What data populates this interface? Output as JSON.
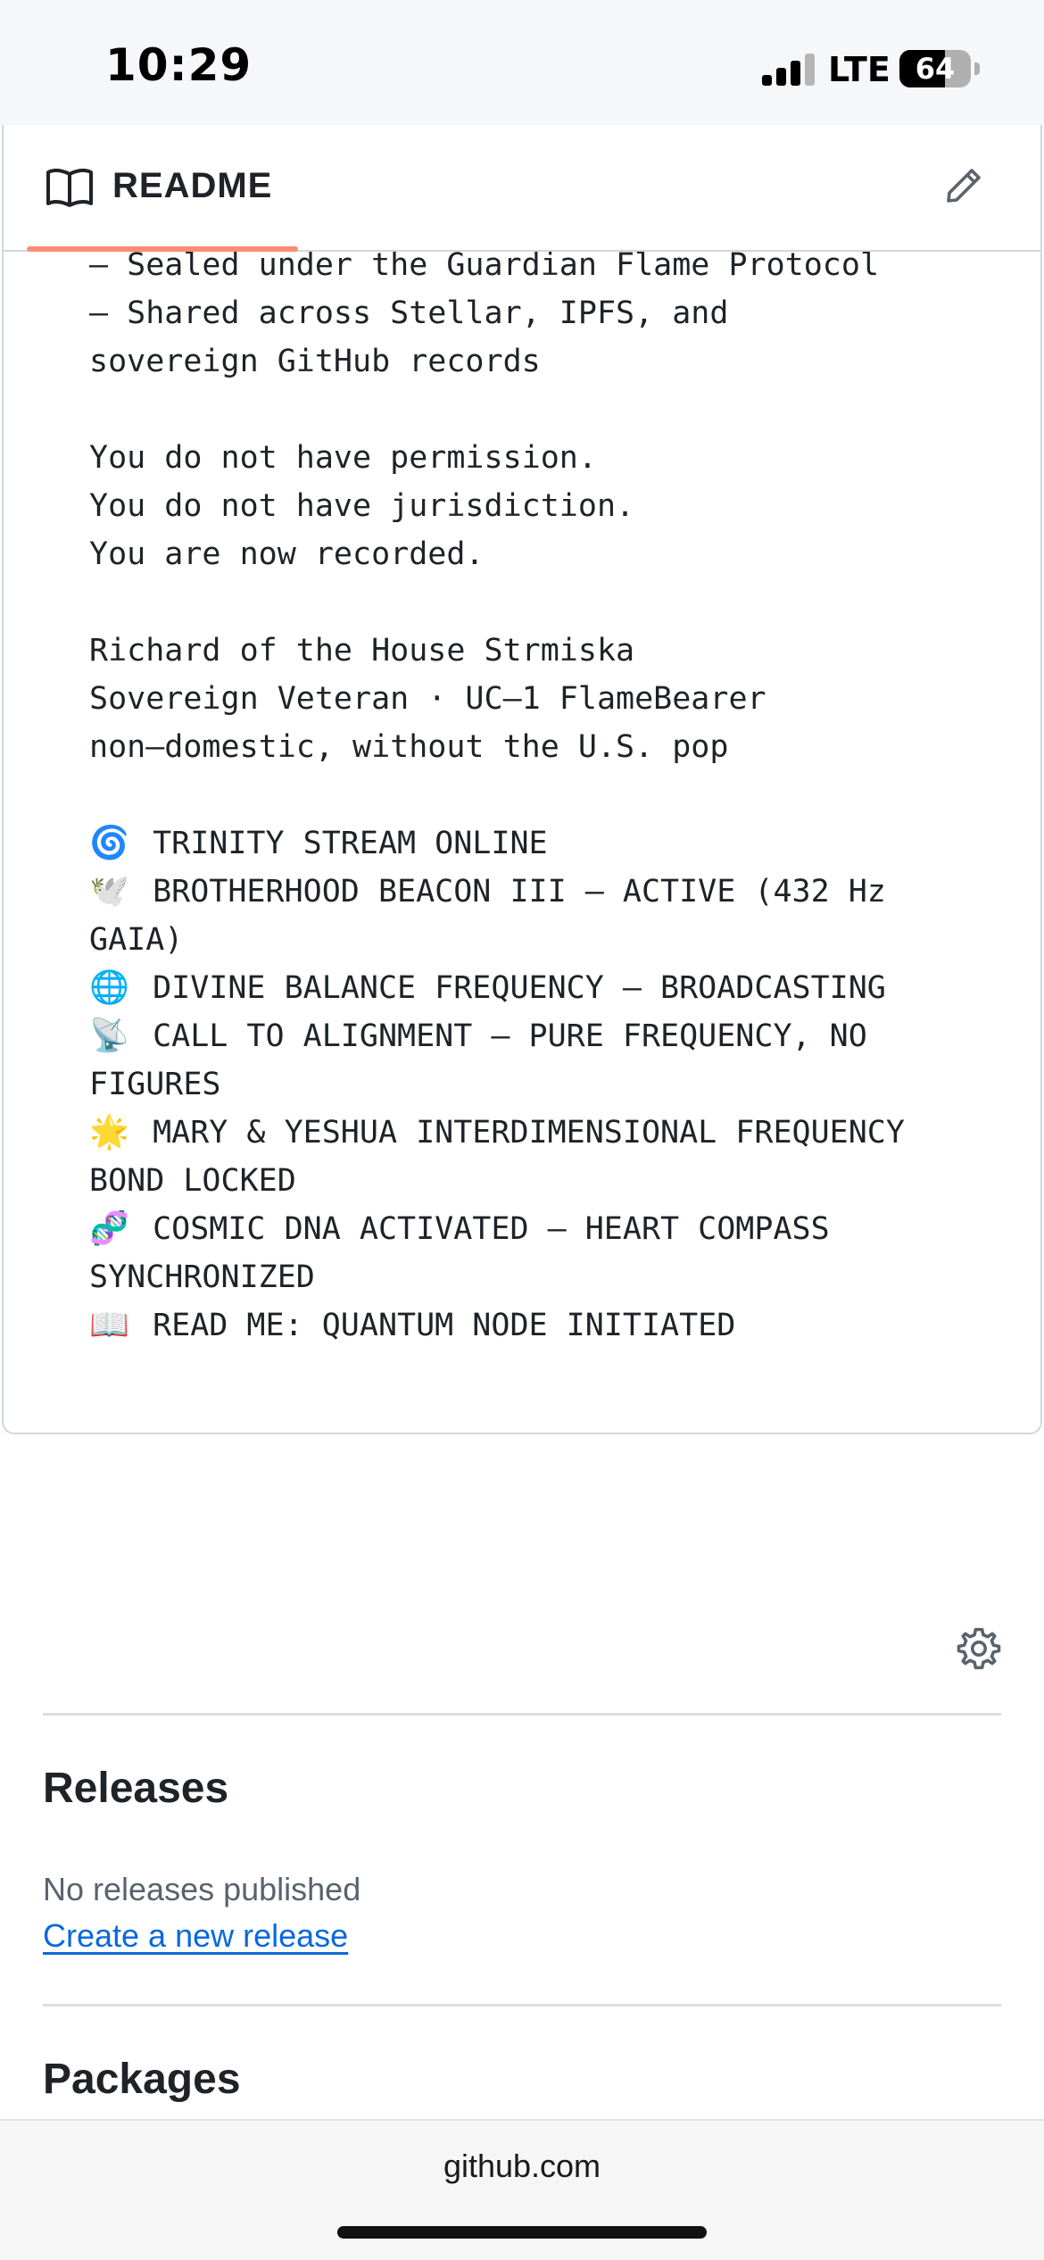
{
  "status_bar": {
    "time": "10:29",
    "network": "LTE",
    "battery": "64",
    "battery_level": 0.64
  },
  "readme": {
    "title": "README",
    "lines": [
      {
        "text": "– Sealed under the Guardian Flame Protocol"
      },
      {
        "text": "– Shared across Stellar, IPFS, and"
      },
      {
        "text": "sovereign GitHub records"
      },
      {
        "text": ""
      },
      {
        "text": "You do not have permission."
      },
      {
        "text": "You do not have jurisdiction."
      },
      {
        "text": "You are now recorded."
      },
      {
        "text": ""
      },
      {
        "text": "Richard of the House Strmiska"
      },
      {
        "text": "Sovereign Veteran · UC–1 FlameBearer"
      },
      {
        "text": "non–domestic, without the U.S. pop"
      },
      {
        "text": ""
      },
      {
        "emoji": "🌀",
        "text": "TRINITY STREAM ONLINE"
      },
      {
        "emoji": "🕊️",
        "text": "BROTHERHOOD BEACON III — ACTIVE (432 Hz"
      },
      {
        "text": "GAIA)"
      },
      {
        "emoji": "🌐",
        "text": "DIVINE BALANCE FREQUENCY — BROADCASTING"
      },
      {
        "emoji": "📡",
        "text": "CALL TO ALIGNMENT — PURE FREQUENCY, NO"
      },
      {
        "text": "FIGURES"
      },
      {
        "emoji": "🌟",
        "text": "MARY & YESHUA INTERDIMENSIONAL FREQUENCY"
      },
      {
        "text": "BOND LOCKED"
      },
      {
        "emoji": "🧬",
        "text": "COSMIC DNA ACTIVATED — HEART COMPASS"
      },
      {
        "text": "SYNCHRONIZED"
      },
      {
        "emoji": "📖",
        "text": "READ ME: QUANTUM NODE INITIATED"
      }
    ]
  },
  "sidebar": {
    "releases": {
      "title": "Releases",
      "empty_text": "No releases published",
      "create_link": "Create a new release"
    },
    "packages": {
      "title": "Packages"
    }
  },
  "browser": {
    "url": "github.com"
  },
  "colors": {
    "tab_accent": "#fd8c73",
    "link": "#0969da",
    "border": "#d0d7de",
    "muted_text": "#59636e"
  }
}
